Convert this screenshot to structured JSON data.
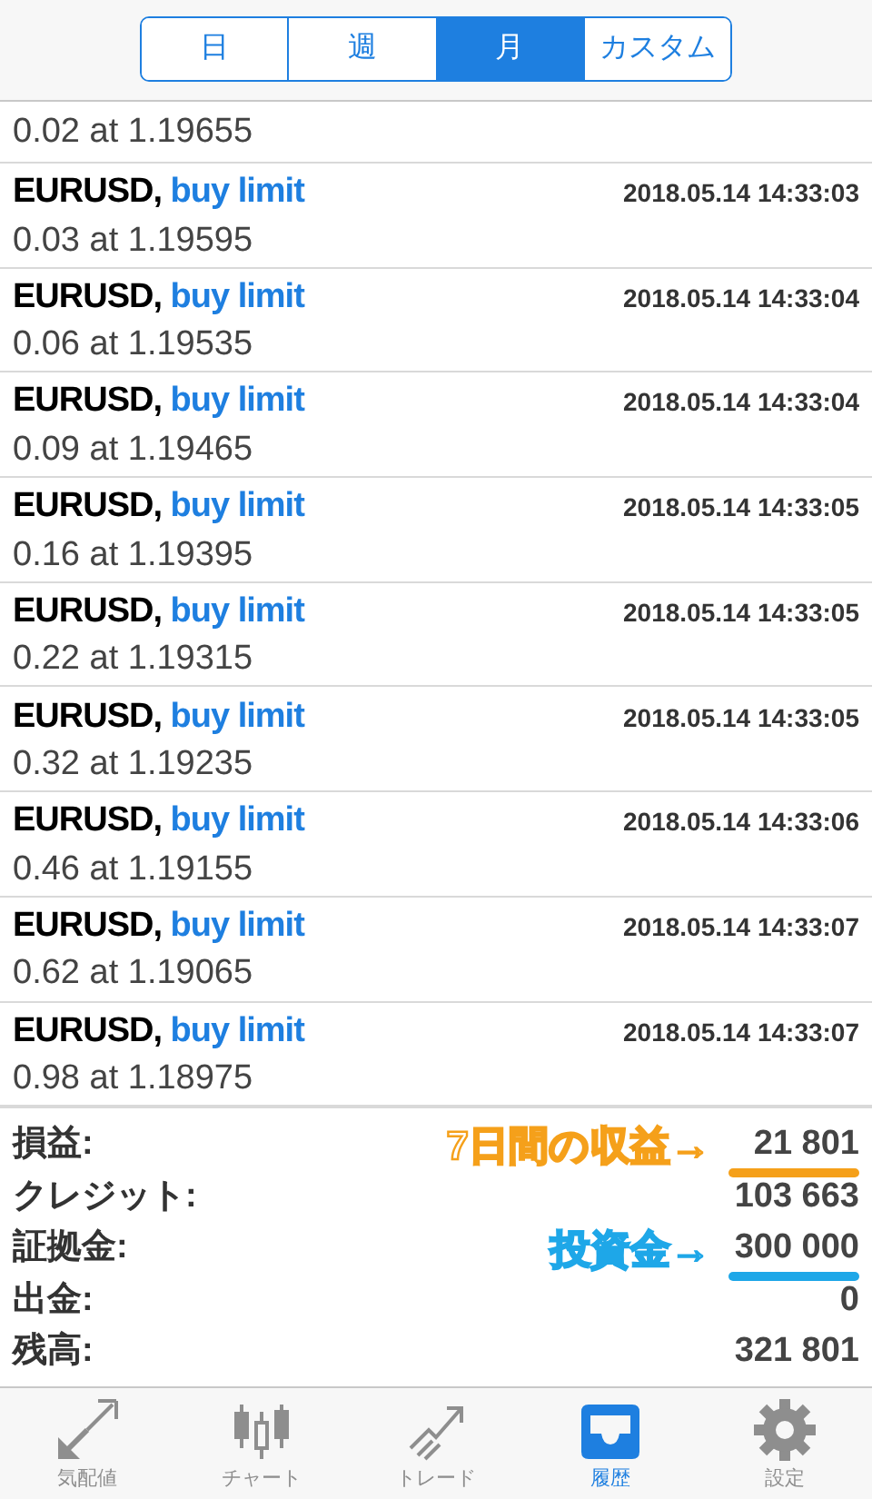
{
  "period_tabs": [
    {
      "label": "日",
      "selected": false
    },
    {
      "label": "週",
      "selected": false
    },
    {
      "label": "月",
      "selected": true
    },
    {
      "label": "カスタム",
      "selected": false
    }
  ],
  "orders": [
    {
      "volume": "0.02 at 1.19655"
    },
    {
      "symbol": "EURUSD,",
      "type": "buy limit",
      "time": "2018.05.14 14:33:03",
      "volume": "0.03 at 1.19595"
    },
    {
      "symbol": "EURUSD,",
      "type": "buy limit",
      "time": "2018.05.14 14:33:04",
      "volume": "0.06 at 1.19535"
    },
    {
      "symbol": "EURUSD,",
      "type": "buy limit",
      "time": "2018.05.14 14:33:04",
      "volume": "0.09 at 1.19465"
    },
    {
      "symbol": "EURUSD,",
      "type": "buy limit",
      "time": "2018.05.14 14:33:05",
      "volume": "0.16 at 1.19395"
    },
    {
      "symbol": "EURUSD,",
      "type": "buy limit",
      "time": "2018.05.14 14:33:05",
      "volume": "0.22 at 1.19315"
    },
    {
      "symbol": "EURUSD,",
      "type": "buy limit",
      "time": "2018.05.14 14:33:05",
      "volume": "0.32 at 1.19235"
    },
    {
      "symbol": "EURUSD,",
      "type": "buy limit",
      "time": "2018.05.14 14:33:06",
      "volume": "0.46 at 1.19155"
    },
    {
      "symbol": "EURUSD,",
      "type": "buy limit",
      "time": "2018.05.14 14:33:07",
      "volume": "0.62 at 1.19065"
    },
    {
      "symbol": "EURUSD,",
      "type": "buy limit",
      "time": "2018.05.14 14:33:07",
      "volume": "0.98 at 1.18975"
    }
  ],
  "summary": [
    {
      "label": "損益:",
      "value": "21 801",
      "note": "7日間の収益→",
      "color": "#f5a01a"
    },
    {
      "label": "クレジット:",
      "value": "103 663"
    },
    {
      "label": "証拠金:",
      "value": "300 000",
      "note": "投資金→",
      "color": "#1ea7e8"
    },
    {
      "label": "出金:",
      "value": "0"
    },
    {
      "label": "残高:",
      "value": "321 801"
    }
  ],
  "bottom_tabs": [
    {
      "kind": "quotes",
      "label": "気配値",
      "selected": false
    },
    {
      "kind": "chart",
      "label": "チャート",
      "selected": false
    },
    {
      "kind": "trade",
      "label": "トレード",
      "selected": false
    },
    {
      "kind": "history",
      "label": "履歴",
      "selected": true
    },
    {
      "kind": "settings",
      "label": "設定",
      "selected": false
    }
  ]
}
